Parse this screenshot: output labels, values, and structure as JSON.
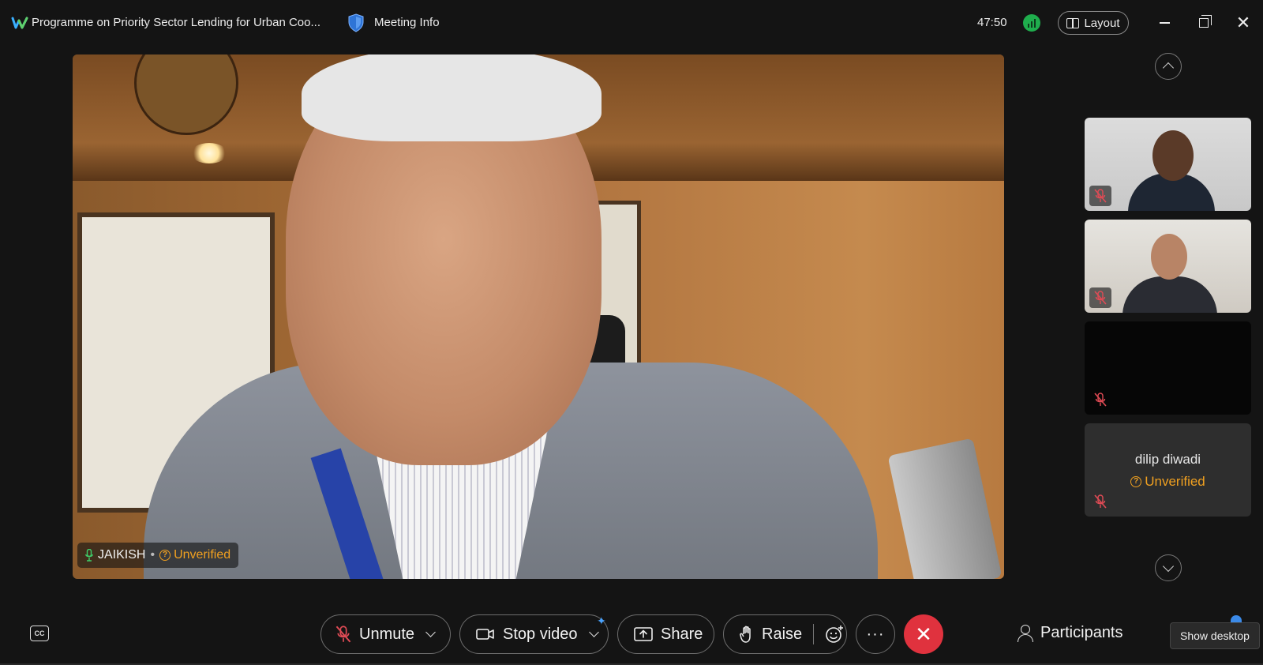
{
  "titlebar": {
    "meeting_title": "Programme on Priority Sector Lending for Urban Coo...",
    "meeting_info_label": "Meeting Info",
    "timer": "47:50",
    "layout_label": "Layout",
    "network_status_color": "#1fae4d"
  },
  "main_video": {
    "participant_name": "JAIKISH",
    "separator": "•",
    "verification": "Unverified"
  },
  "rail": {
    "tiles": [
      {
        "name": "",
        "muted": true
      },
      {
        "name": "",
        "muted": true
      },
      {
        "name": "",
        "muted": true
      },
      {
        "name": "dilip diwadi",
        "verification": "Unverified",
        "muted": true
      }
    ]
  },
  "toolbar": {
    "unmute_label": "Unmute",
    "stop_video_label": "Stop video",
    "share_label": "Share",
    "raise_label": "Raise",
    "more_label": "···",
    "end_icon": "close-icon",
    "participants_label": "Participants",
    "tooltip": "Show desktop",
    "end_color": "#e0323e",
    "accent_warning": "#f0a020"
  }
}
